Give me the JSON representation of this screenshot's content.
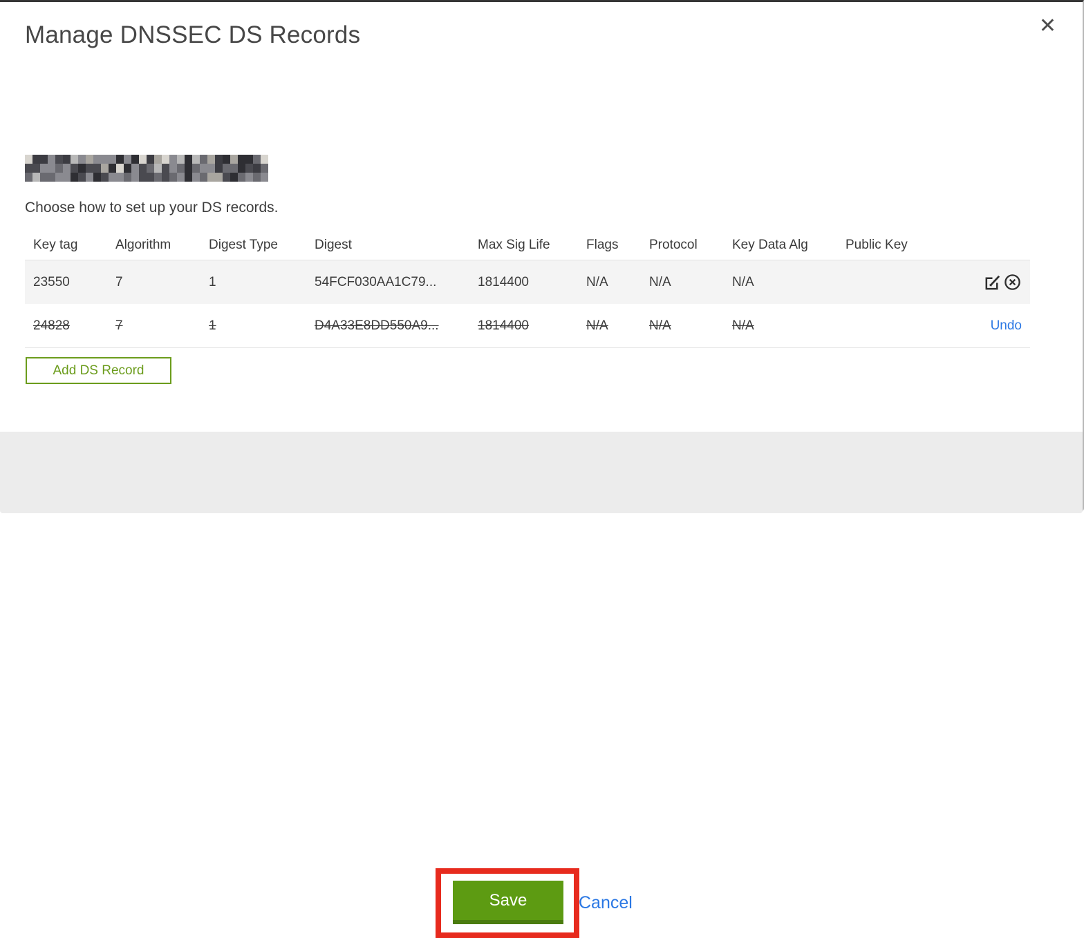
{
  "modal": {
    "title": "Manage DNSSEC DS Records",
    "close_icon": "✕",
    "domain": {
      "redacted": true
    },
    "subtitle": "Choose how to set up your DS records.",
    "table": {
      "columns": [
        "Key tag",
        "Algorithm",
        "Digest Type",
        "Digest",
        "Max Sig Life",
        "Flags",
        "Protocol",
        "Key Data Alg",
        "Public Key"
      ],
      "rows": [
        {
          "key_tag": "23550",
          "algorithm": "7",
          "digest_type": "1",
          "digest": "54FCF030AA1C79...",
          "max_sig_life": "1814400",
          "flags": "N/A",
          "protocol": "N/A",
          "key_data_alg": "N/A",
          "public_key": "",
          "deleted": false,
          "actions": [
            "edit",
            "remove"
          ]
        },
        {
          "key_tag": "24828",
          "algorithm": "7",
          "digest_type": "1",
          "digest": "D4A33E8DD550A9...",
          "max_sig_life": "1814400",
          "flags": "N/A",
          "protocol": "N/A",
          "key_data_alg": "N/A",
          "public_key": "",
          "deleted": true,
          "actions": [
            "undo"
          ],
          "undo_label": "Undo"
        }
      ]
    },
    "add_button_label": "Add DS Record",
    "footer": {
      "save_label": "Save",
      "cancel_label": "Cancel"
    }
  },
  "colors": {
    "accent_green": "#5d9b12",
    "accent_green_dark": "#4a7c0f",
    "outline_green": "#6b9c1c",
    "link_blue": "#2b78e4",
    "annotation_red": "#e72b1e",
    "row_stripe": "#f4f4f4",
    "footer_gray": "#ececec"
  },
  "redaction_palette": [
    "#2e2e33",
    "#4a4a50",
    "#6a6a70",
    "#8a8a90",
    "#b8b8b8",
    "#d8d5cf",
    "#3c3c42",
    "#a9a6a0"
  ]
}
